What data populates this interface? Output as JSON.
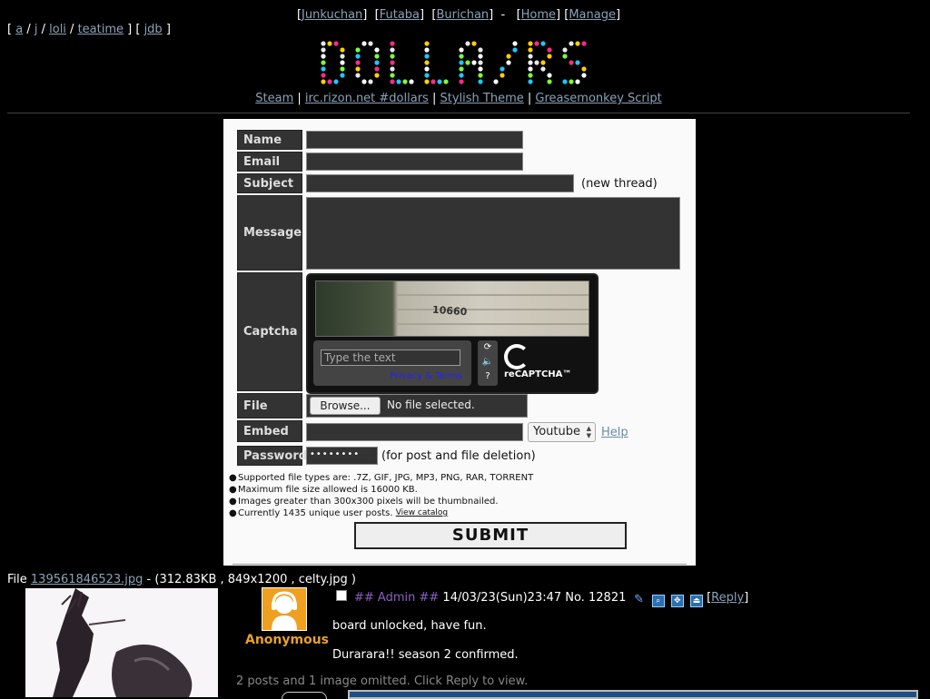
{
  "topnav": {
    "links": [
      "Junkuchan",
      "Futaba",
      "Burichan",
      "Home",
      "Manage"
    ]
  },
  "boardnav": {
    "boards": [
      "a",
      "j",
      "loli",
      "teatime",
      "jdb"
    ]
  },
  "banner": {
    "text": "DOLLARS"
  },
  "header_links": [
    "Steam",
    "irc.rizon.net #dollars",
    "Stylish Theme",
    "Greasemonkey Script"
  ],
  "form": {
    "labels": {
      "name": "Name",
      "email": "Email",
      "subject": "Subject",
      "message": "Message",
      "captcha": "Captcha",
      "file": "File",
      "embed": "Embed",
      "password": "Password"
    },
    "subject_note": "(new thread)",
    "captcha": {
      "image_text": "10660",
      "placeholder": "Type the text",
      "privacy": "Privacy & Terms",
      "brand": "reCAPTCHA™"
    },
    "file": {
      "browse": "Browse...",
      "status": "No file selected."
    },
    "embed": {
      "selected": "Youtube",
      "help": "Help"
    },
    "password": {
      "value": "••••••••",
      "note": "(for post and file deletion)"
    },
    "rules": [
      "Supported file types are: .7Z, GIF, JPG, MP3, PNG, RAR, TORRENT",
      "Maximum file size allowed is 16000 KB.",
      "Images greater than 300x300 pixels will be thumbnailed.",
      "Currently 1435 unique user posts."
    ],
    "view_catalog": "View catalog",
    "submit": "SUBMIT"
  },
  "post": {
    "file_label": "File",
    "file_link": "139561846523.jpg",
    "file_meta": "- (312.83KB , 849x1200 , celty.jpg )",
    "poster": "Anonymous",
    "trip": "## Admin ##",
    "datetime": "14/03/23(Sun)23:47",
    "number": "No. 12821",
    "reply": "Reply",
    "messages": [
      "board unlocked, have fun.",
      "Durarara!! season 2 confirmed."
    ],
    "omitted": "2 posts and 1 image omitted. Click Reply to view."
  },
  "colors": {
    "background": "#000000",
    "link": "#8aa2b8",
    "poster": "#e8a030",
    "trip": "#8a5fc0"
  }
}
